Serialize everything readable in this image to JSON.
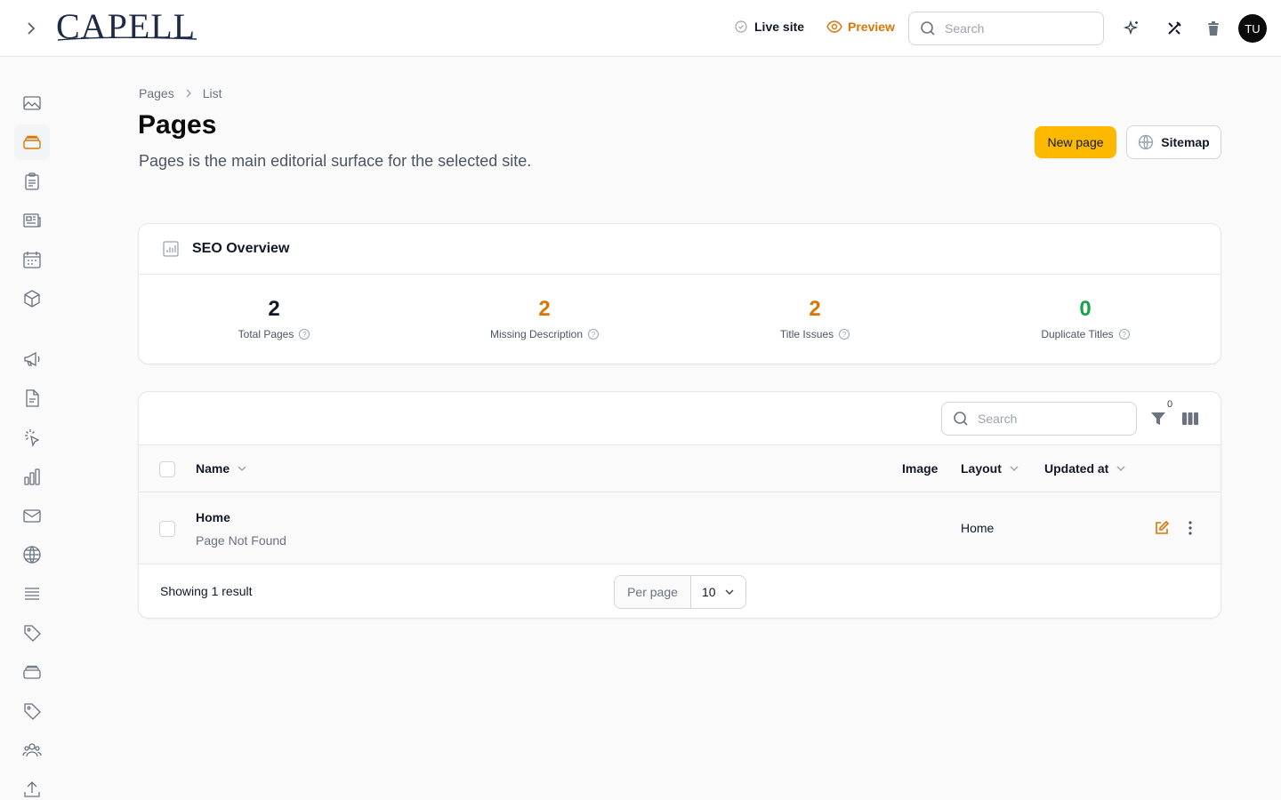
{
  "topbar": {
    "logo_text": "CAPELL",
    "live_site_label": "Live site",
    "preview_label": "Preview",
    "search_placeholder": "Search",
    "avatar_initials": "TU"
  },
  "sidebar": {
    "items": [
      {
        "icon": "image-icon",
        "active": false
      },
      {
        "icon": "stack-icon",
        "active": true
      },
      {
        "icon": "clipboard-icon",
        "active": false
      },
      {
        "icon": "newspaper-icon",
        "active": false
      },
      {
        "icon": "calendar-icon",
        "active": false
      },
      {
        "icon": "cube-icon",
        "active": false
      },
      {
        "icon": "megaphone-icon",
        "active": false
      },
      {
        "icon": "document-icon",
        "active": false
      },
      {
        "icon": "cursor-click-icon",
        "active": false
      },
      {
        "icon": "bar-chart-icon",
        "active": false
      },
      {
        "icon": "envelope-icon",
        "active": false
      },
      {
        "icon": "globe-icon",
        "active": false
      },
      {
        "icon": "list-icon",
        "active": false
      },
      {
        "icon": "tag-icon",
        "active": false
      },
      {
        "icon": "stack-icon",
        "active": false
      },
      {
        "icon": "tag-icon",
        "active": false
      },
      {
        "icon": "users-icon",
        "active": false
      },
      {
        "icon": "upload-icon",
        "active": false
      }
    ]
  },
  "breadcrumb": {
    "items": [
      "Pages",
      "List"
    ]
  },
  "header": {
    "title": "Pages",
    "description": "Pages is the main editorial surface for the selected site.",
    "new_page_label": "New page",
    "sitemap_label": "Sitemap"
  },
  "seo": {
    "title": "SEO Overview",
    "stats": [
      {
        "value": "2",
        "label": "Total Pages",
        "color": "#111827"
      },
      {
        "value": "2",
        "label": "Missing Description",
        "color": "#d97706"
      },
      {
        "value": "2",
        "label": "Title Issues",
        "color": "#d97706"
      },
      {
        "value": "0",
        "label": "Duplicate Titles",
        "color": "#16a34a"
      }
    ]
  },
  "table": {
    "search_placeholder": "Search",
    "filter_count": "0",
    "columns": {
      "name": "Name",
      "image": "Image",
      "layout": "Layout",
      "updated_at": "Updated at"
    },
    "rows": [
      {
        "name": "Home",
        "subtitle": "Page Not Found",
        "layout": "Home"
      }
    ],
    "showing": "Showing 1 result",
    "per_page_label": "Per page",
    "per_page_value": "10"
  },
  "colors": {
    "accent": "#fcb900",
    "warning": "#d97706",
    "success": "#16a34a"
  }
}
